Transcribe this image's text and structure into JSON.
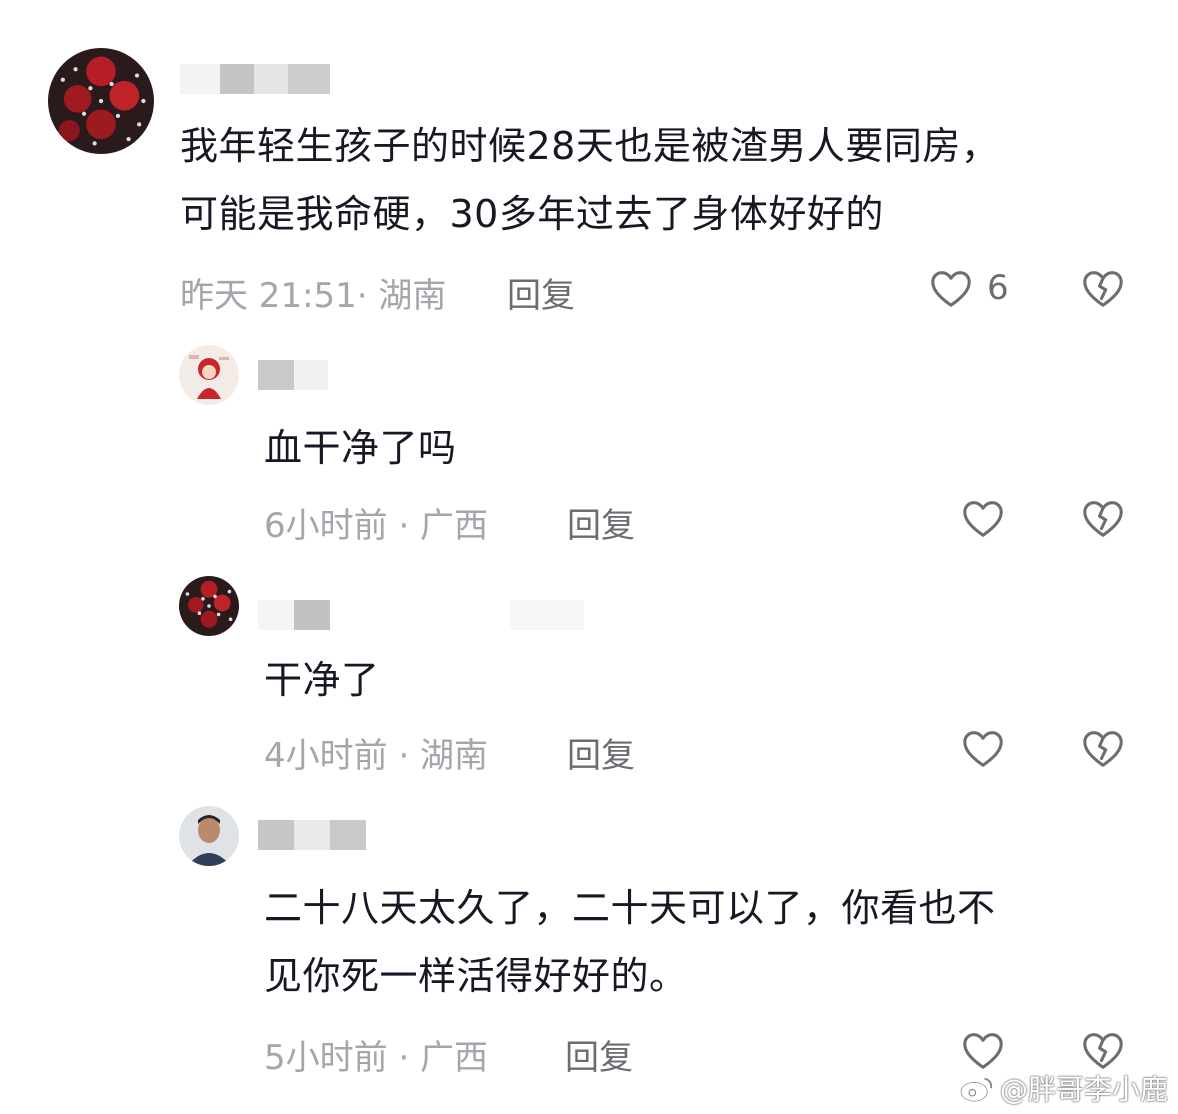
{
  "comments": [
    {
      "text": "我年轻生孩子的时候28天也是被渣男人要同房，\n可能是我命硬，30多年过去了身体好好的",
      "meta": "昨天 21:51· 湖南",
      "reply": "回复",
      "likes": "6"
    },
    {
      "text": "血干净了吗",
      "meta": "6小时前 · 广西",
      "reply": "回复"
    },
    {
      "text": "干净了",
      "meta": "4小时前 · 湖南",
      "reply": "回复"
    },
    {
      "text": "二十八天太久了，二十天可以了，你看也不\n见你死一样活得好好的。",
      "meta": "5小时前 · 广西",
      "reply": "回复"
    }
  ],
  "watermark": "@胖哥李小鹿",
  "icons": {
    "like": "heart-outline-icon",
    "dislike": "broken-heart-icon",
    "watermark": "weibo-logo-icon"
  },
  "colors": {
    "text": "#161823",
    "meta": "#a4a6ab",
    "reply": "#6b6d72",
    "icon": "#6b6d72"
  }
}
